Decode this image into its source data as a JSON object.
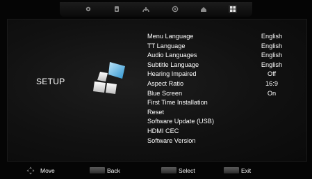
{
  "top_menu": {
    "icons": [
      "picture-icon",
      "sound-icon",
      "channel-icon",
      "lock-icon",
      "home-icon",
      "setup-grid-icon"
    ],
    "active": "setup-grid-icon"
  },
  "screen": {
    "title": "SETUP"
  },
  "menu": {
    "items": [
      {
        "label": "Menu Language",
        "value": "English"
      },
      {
        "label": "TT Language",
        "value": "English"
      },
      {
        "label": "Audio Languages",
        "value": "English"
      },
      {
        "label": "Subtitle Language",
        "value": "English"
      },
      {
        "label": "Hearing Impaired",
        "value": "Off"
      },
      {
        "label": "Aspect Ratio",
        "value": "16:9"
      },
      {
        "label": "Blue Screen",
        "value": "On"
      },
      {
        "label": "First Time Installation",
        "value": ""
      },
      {
        "label": "Reset",
        "value": ""
      },
      {
        "label": "Software Update (USB)",
        "value": ""
      },
      {
        "label": "HDMI CEC",
        "value": ""
      },
      {
        "label": "Software Version",
        "value": ""
      }
    ]
  },
  "hints": {
    "move": "Move",
    "back": "Back",
    "select": "Select",
    "exit": "Exit"
  },
  "colors": {
    "accent": "#3ea6dc",
    "text": "#ffffff"
  }
}
